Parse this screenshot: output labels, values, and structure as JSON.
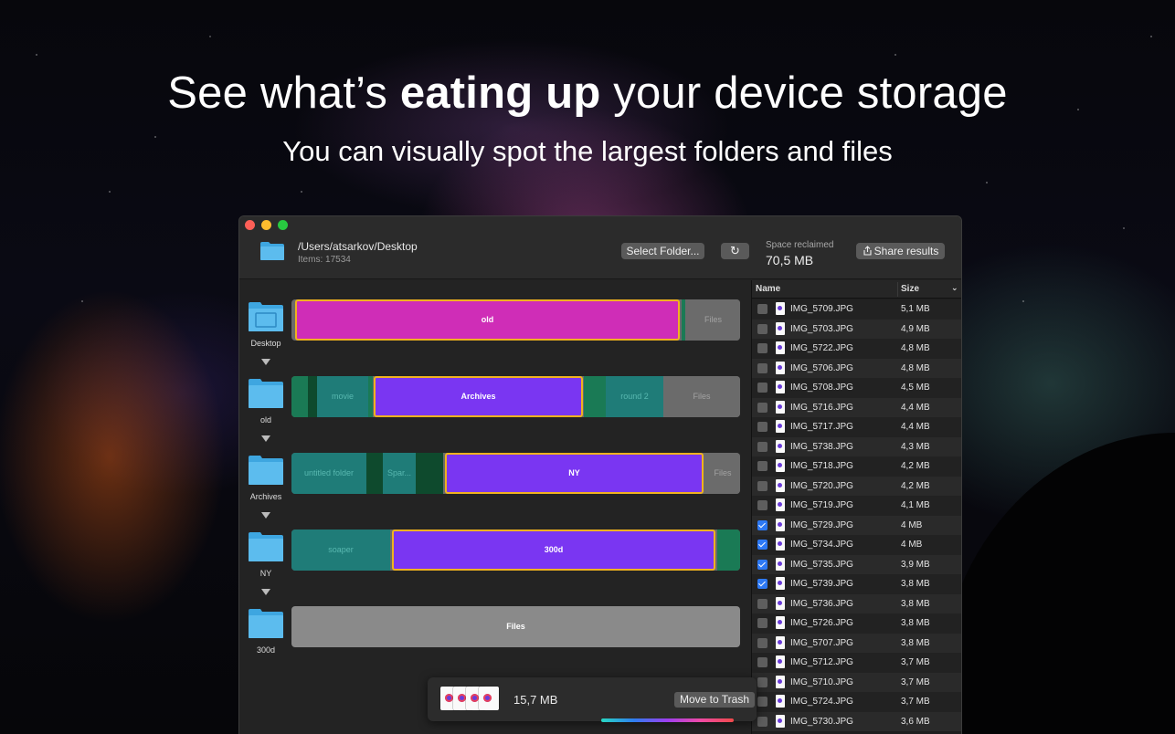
{
  "hero": {
    "headline_pre": "See what’s ",
    "headline_bold": "eating up",
    "headline_post": " your device storage",
    "subheadline": "You can visually spot the largest folders and files"
  },
  "window": {
    "path": "/Users/atsarkov/Desktop",
    "items": "Items: 17534",
    "select_folder": "Select Folder...",
    "refresh_icon": "↻",
    "space_reclaimed_label": "Space reclaimed",
    "space_reclaimed_value": "70,5 MB",
    "share_results": "Share results"
  },
  "tree": {
    "nodes": [
      "Desktop",
      "old",
      "Archives",
      "NY",
      "300d"
    ],
    "bars": [
      {
        "segments": [
          "old",
          "Files"
        ]
      },
      {
        "segments": [
          "movie",
          "Archives",
          "round 2",
          "Files"
        ]
      },
      {
        "segments": [
          "untitled folder",
          "Spar...",
          "NY",
          "Files"
        ]
      },
      {
        "segments": [
          "soaper",
          "300d"
        ]
      },
      {
        "segments": [
          "Files"
        ]
      }
    ]
  },
  "list": {
    "col_name": "Name",
    "col_size": "Size",
    "rows": [
      {
        "name": "IMG_5709.JPG",
        "size": "5,1 MB",
        "checked": false
      },
      {
        "name": "IMG_5703.JPG",
        "size": "4,9 MB",
        "checked": false
      },
      {
        "name": "IMG_5722.JPG",
        "size": "4,8 MB",
        "checked": false
      },
      {
        "name": "IMG_5706.JPG",
        "size": "4,8 MB",
        "checked": false
      },
      {
        "name": "IMG_5708.JPG",
        "size": "4,5 MB",
        "checked": false
      },
      {
        "name": "IMG_5716.JPG",
        "size": "4,4 MB",
        "checked": false
      },
      {
        "name": "IMG_5717.JPG",
        "size": "4,4 MB",
        "checked": false
      },
      {
        "name": "IMG_5738.JPG",
        "size": "4,3 MB",
        "checked": false
      },
      {
        "name": "IMG_5718.JPG",
        "size": "4,2 MB",
        "checked": false
      },
      {
        "name": "IMG_5720.JPG",
        "size": "4,2 MB",
        "checked": false
      },
      {
        "name": "IMG_5719.JPG",
        "size": "4,1 MB",
        "checked": false
      },
      {
        "name": "IMG_5729.JPG",
        "size": "4 MB",
        "checked": true
      },
      {
        "name": "IMG_5734.JPG",
        "size": "4 MB",
        "checked": true
      },
      {
        "name": "IMG_5735.JPG",
        "size": "3,9 MB",
        "checked": true
      },
      {
        "name": "IMG_5739.JPG",
        "size": "3,8 MB",
        "checked": true
      },
      {
        "name": "IMG_5736.JPG",
        "size": "3,8 MB",
        "checked": false
      },
      {
        "name": "IMG_5726.JPG",
        "size": "3,8 MB",
        "checked": false
      },
      {
        "name": "IMG_5707.JPG",
        "size": "3,8 MB",
        "checked": false
      },
      {
        "name": "IMG_5712.JPG",
        "size": "3,7 MB",
        "checked": false
      },
      {
        "name": "IMG_5710.JPG",
        "size": "3,7 MB",
        "checked": false
      },
      {
        "name": "IMG_5724.JPG",
        "size": "3,7 MB",
        "checked": false
      },
      {
        "name": "IMG_5730.JPG",
        "size": "3,6 MB",
        "checked": false
      }
    ]
  },
  "trash": {
    "size": "15,7 MB",
    "button": "Move to Trash"
  },
  "colors": {
    "selected_outline": "#f0b21f",
    "magenta": "#cf2db7",
    "purple": "#7a36f2",
    "teal": "#1f7c78",
    "checkbox_on": "#2d79f5"
  },
  "icons": [
    "folder-icon",
    "refresh-icon",
    "share-icon",
    "file-icon",
    "chevron-down-icon",
    "triangle-down-icon"
  ]
}
